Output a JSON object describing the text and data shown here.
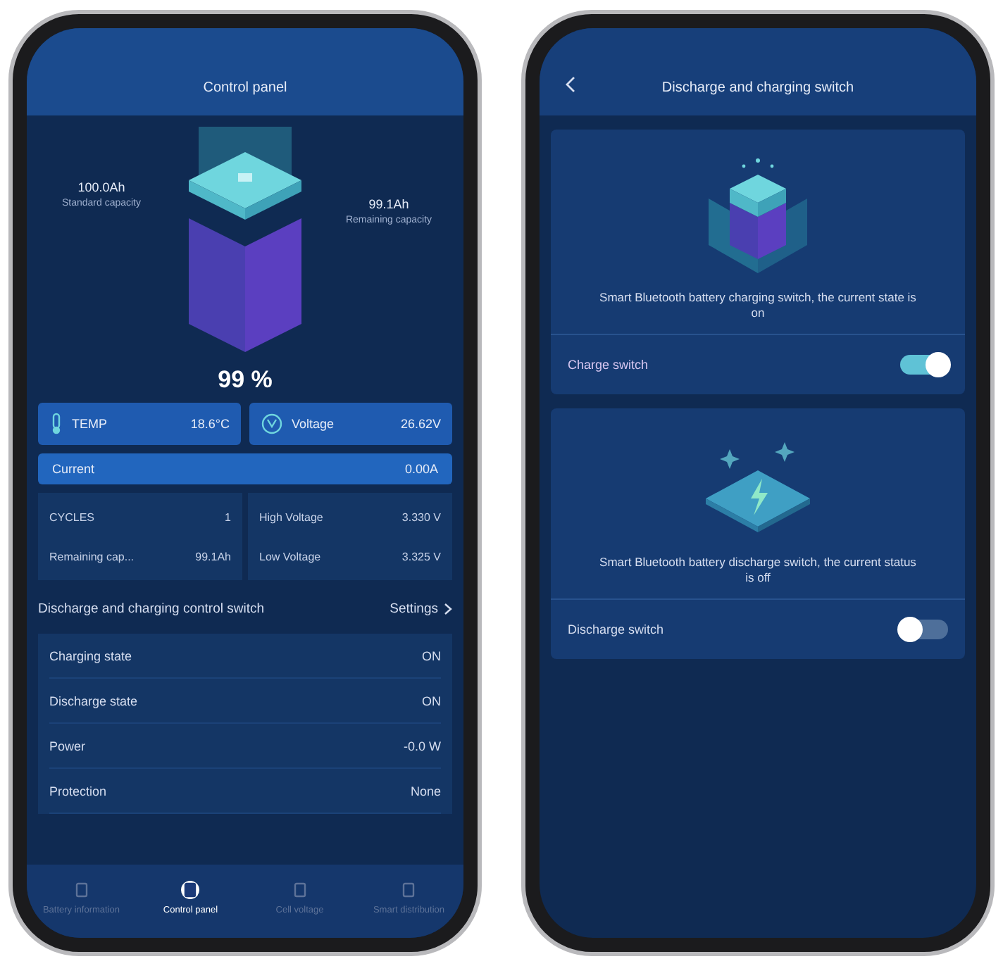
{
  "control_panel": {
    "title": "Control panel",
    "capacity": {
      "standard_value": "100.0Ah",
      "standard_label": "Standard capacity",
      "remaining_value": "99.1Ah",
      "remaining_label": "Remaining capacity"
    },
    "percent": "99 %",
    "metrics": [
      {
        "kind": "temp",
        "label": "TEMP",
        "value": "18.6°C"
      },
      {
        "kind": "voltage",
        "label": "Voltage",
        "value": "26.62V"
      }
    ],
    "current": {
      "label": "Current",
      "value": "0.00A"
    },
    "stats_left": [
      {
        "label": "CYCLES",
        "value": "1"
      },
      {
        "label": "Remaining cap...",
        "value": "99.1Ah"
      }
    ],
    "stats_right": [
      {
        "label": "High Voltage",
        "value": "3.330 V"
      },
      {
        "label": "Low Voltage",
        "value": "3.325 V"
      }
    ],
    "switch_link": {
      "label": "Discharge and charging control switch",
      "action": "Settings"
    },
    "status_rows": [
      {
        "label": "Charging state",
        "value": "ON"
      },
      {
        "label": "Discharge state",
        "value": "ON"
      },
      {
        "label": "Power",
        "value": "-0.0 W"
      },
      {
        "label": "Protection",
        "value": "None"
      }
    ],
    "nav": [
      {
        "label": "Battery information",
        "selected": false
      },
      {
        "label": "Control panel",
        "selected": true
      },
      {
        "label": "Cell voltage",
        "selected": false
      },
      {
        "label": "Smart distribution",
        "selected": false
      }
    ]
  },
  "switch_screen": {
    "title": "Discharge and charging switch",
    "cards": [
      {
        "kind": "charge",
        "description": "Smart Bluetooth battery charging switch, the current state is on",
        "label": "Charge switch",
        "on": true
      },
      {
        "kind": "discharge",
        "description": "Smart Bluetooth battery discharge switch, the current status is off",
        "label": "Discharge switch",
        "on": false
      }
    ]
  }
}
